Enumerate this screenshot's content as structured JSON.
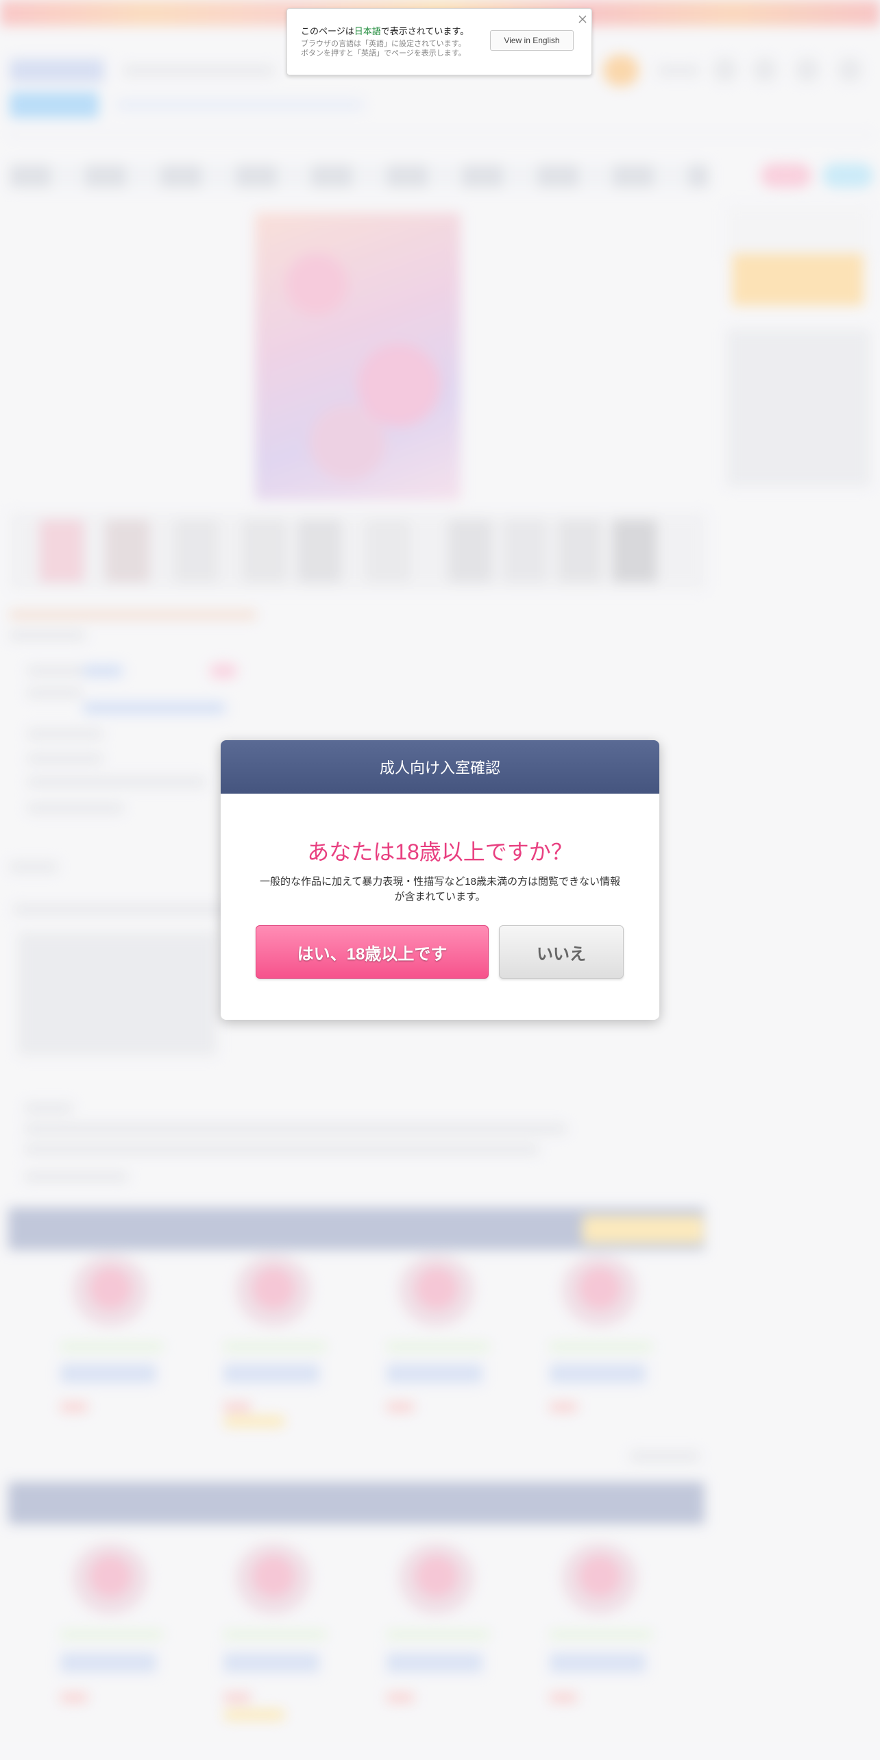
{
  "language_banner": {
    "title_prefix": "このページは",
    "title_language": "日本語",
    "title_suffix": "で表示されています。",
    "sub_line1": "ブラウザの言語は「英語」に設定されています。",
    "sub_line2": "ボタンを押すと「英語」でページを表示します。",
    "button_label": "View in English",
    "close_icon": "close-icon",
    "highlight_color": "#1f8b3b"
  },
  "age_modal": {
    "header_title": "成人向け入室確認",
    "question": "あなたは18歳以上ですか？",
    "description": "一般的な作品に加えて暴力表現・性描写など18歳未満の方は閲覧できない情報が含まれています。",
    "yes_label": "はい、18歳以上です",
    "no_label": "いいえ",
    "colors": {
      "header": "#4a5a85",
      "question": "#e83f80",
      "yes_button": "#f6538c",
      "no_button": "#e6e6e6"
    }
  },
  "background": {
    "blurred": true
  }
}
